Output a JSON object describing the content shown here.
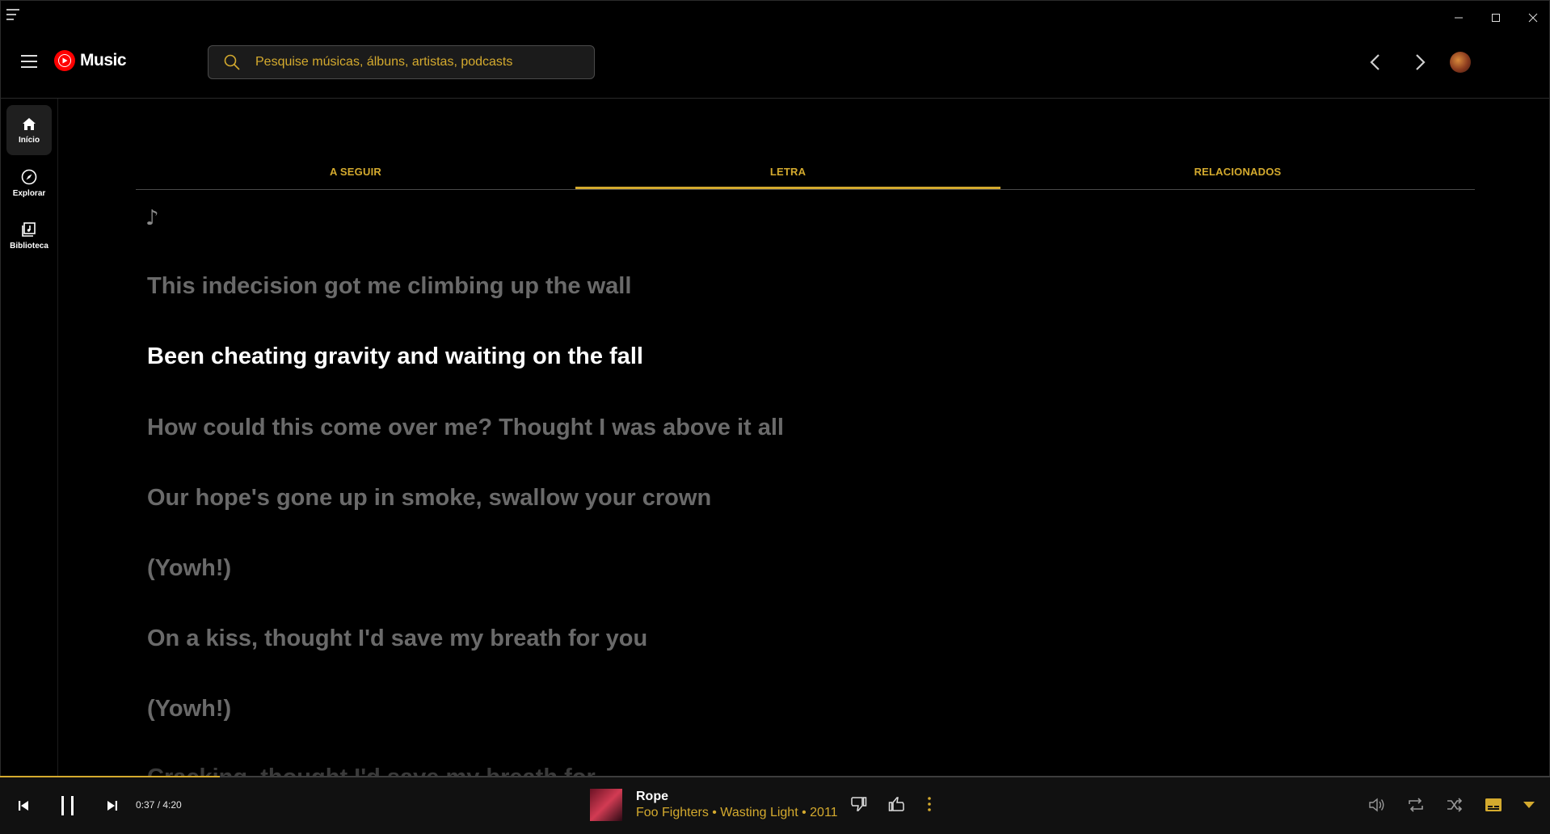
{
  "header": {
    "logo_text": "Music",
    "search_placeholder": "Pesquise músicas, álbuns, artistas, podcasts"
  },
  "sidebar": {
    "items": [
      {
        "label": "Início",
        "icon": "home-icon",
        "active": true
      },
      {
        "label": "Explorar",
        "icon": "compass-icon",
        "active": false
      },
      {
        "label": "Biblioteca",
        "icon": "library-icon",
        "active": false
      }
    ]
  },
  "tabs": [
    {
      "label": "A SEGUIR",
      "active": false
    },
    {
      "label": "LETRA",
      "active": true
    },
    {
      "label": "RELACIONADOS",
      "active": false
    }
  ],
  "lyrics": {
    "note": "♪",
    "lines": [
      "This indecision got me climbing up the wall",
      "Been cheating gravity and waiting on the fall",
      "How could this come over me? Thought I was above it all",
      "Our hope's gone up in smoke, swallow your crown",
      "(Yowh!)",
      "On a kiss, thought I'd save my breath for you",
      "(Yowh!)",
      "Cracking, thought I'd save my breath for"
    ],
    "current_index": 1
  },
  "player": {
    "time": "0:37 / 4:20",
    "progress": 0.142,
    "title": "Rope",
    "subtitle": "Foo Fighters • Wasting Light • 2011"
  },
  "colors": {
    "accent": "#d4aa2e",
    "background": "#000000",
    "player_bg": "#111111"
  }
}
